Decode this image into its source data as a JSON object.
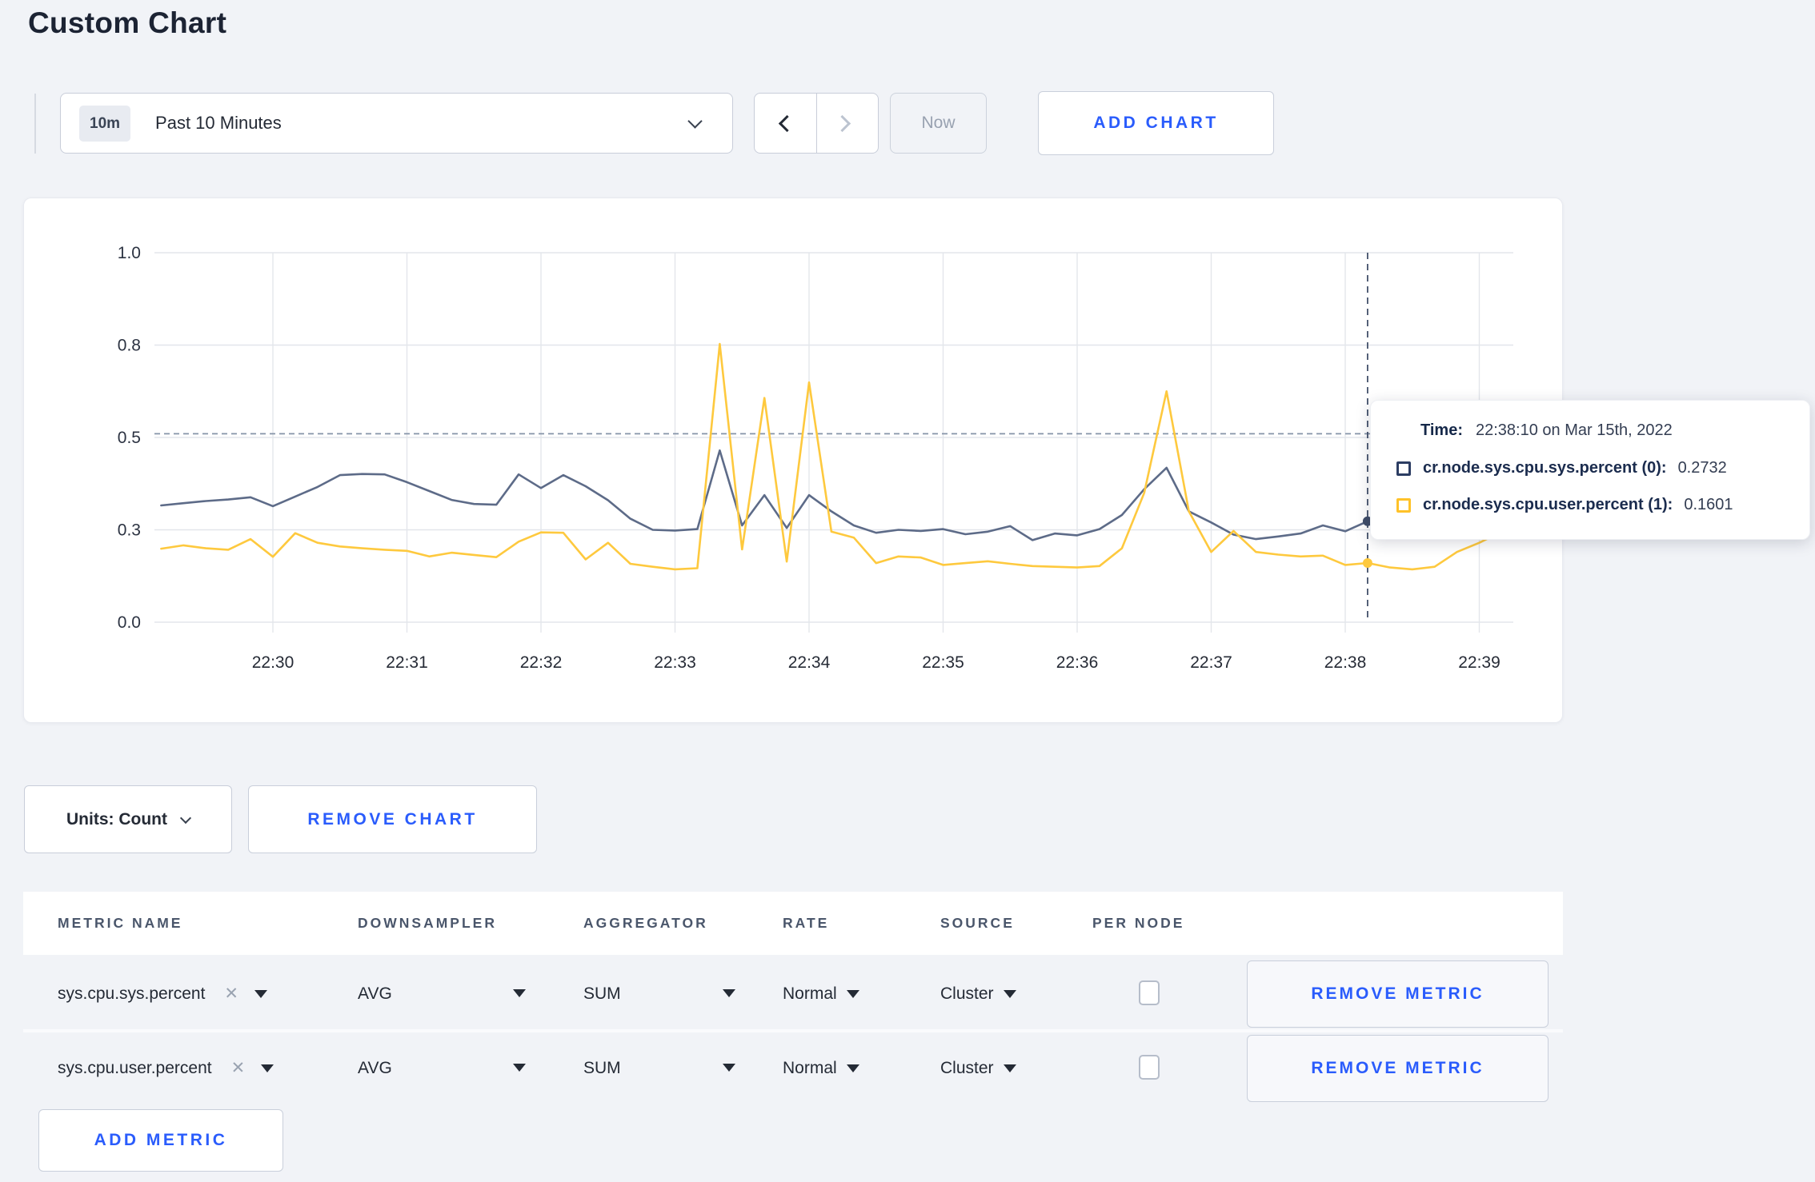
{
  "page": {
    "title": "Custom Chart"
  },
  "toolbar": {
    "time_range_badge": "10m",
    "time_range_label": "Past 10 Minutes",
    "now_label": "Now",
    "add_chart_label": "ADD CHART"
  },
  "tooltip": {
    "time_label": "Time:",
    "time_value": "22:38:10 on Mar 15th, 2022",
    "series": [
      {
        "label": "cr.node.sys.cpu.sys.percent (0):",
        "value": "0.2732",
        "swatch_color": "#2c3d63"
      },
      {
        "label": "cr.node.sys.cpu.user.percent (1):",
        "value": "0.1601",
        "swatch_color": "#ffc229"
      }
    ]
  },
  "chart_footer": {
    "units_label": "Units: Count",
    "remove_chart_label": "REMOVE CHART"
  },
  "metrics_table": {
    "headers": [
      "METRIC NAME",
      "DOWNSAMPLER",
      "AGGREGATOR",
      "RATE",
      "SOURCE",
      "PER NODE"
    ],
    "remove_metric_label": "REMOVE METRIC",
    "add_metric_label": "ADD METRIC",
    "rows": [
      {
        "metric": "sys.cpu.sys.percent",
        "downsampler": "AVG",
        "aggregator": "SUM",
        "rate": "Normal",
        "source": "Cluster",
        "per_node_checked": false
      },
      {
        "metric": "sys.cpu.user.percent",
        "downsampler": "AVG",
        "aggregator": "SUM",
        "rate": "Normal",
        "source": "Cluster",
        "per_node_checked": false
      }
    ]
  },
  "icons": {
    "remove_tag": "✕"
  },
  "chart_data": {
    "type": "line",
    "title": "",
    "xlabel": "",
    "ylabel": "",
    "grid": true,
    "legend_position": "tooltip",
    "ylim": [
      0,
      1
    ],
    "y_axis": {
      "ticks": [
        {
          "label": "1.0",
          "value": 1.0
        },
        {
          "label": "0.8",
          "value": 0.75
        },
        {
          "label": "0.5",
          "value": 0.5
        },
        {
          "label": "0.3",
          "value": 0.25
        },
        {
          "label": "0.0",
          "value": 0.0
        }
      ]
    },
    "x_axis": {
      "tick_labels": [
        "22:30",
        "22:31",
        "22:32",
        "22:33",
        "22:34",
        "22:35",
        "22:36",
        "22:37",
        "22:38",
        "22:39"
      ],
      "tick_minutes": [
        0,
        1,
        2,
        3,
        4,
        5,
        6,
        7,
        8,
        9
      ]
    },
    "x_start_minutes": -0.8333,
    "x_step_minutes": 0.16667,
    "guideline_value": 0.51,
    "crosshair": {
      "time": "22:38:10",
      "minutes": 8.1667,
      "points": [
        {
          "series": 0,
          "value": 0.2732
        },
        {
          "series": 1,
          "value": 0.1601
        }
      ]
    },
    "series": [
      {
        "name": "cr.node.sys.cpu.sys.percent",
        "color": "#5d6b88",
        "values": [
          0.316,
          0.322,
          0.328,
          0.332,
          0.338,
          0.314,
          0.34,
          0.366,
          0.398,
          0.401,
          0.4,
          0.379,
          0.355,
          0.331,
          0.32,
          0.318,
          0.4,
          0.363,
          0.398,
          0.368,
          0.33,
          0.28,
          0.25,
          0.248,
          0.252,
          0.465,
          0.262,
          0.344,
          0.255,
          0.344,
          0.3,
          0.262,
          0.242,
          0.25,
          0.247,
          0.252,
          0.238,
          0.245,
          0.26,
          0.222,
          0.24,
          0.235,
          0.252,
          0.29,
          0.36,
          0.418,
          0.3,
          0.27,
          0.237,
          0.225,
          0.232,
          0.24,
          0.262,
          0.246,
          0.2732,
          0.245,
          0.252,
          0.242,
          0.252,
          0.247,
          0.256
        ]
      },
      {
        "name": "cr.node.sys.cpu.user.percent",
        "color": "#fec93e",
        "values": [
          0.199,
          0.208,
          0.2,
          0.196,
          0.225,
          0.177,
          0.241,
          0.215,
          0.205,
          0.2,
          0.196,
          0.193,
          0.178,
          0.188,
          0.182,
          0.176,
          0.218,
          0.243,
          0.242,
          0.17,
          0.215,
          0.158,
          0.15,
          0.143,
          0.146,
          0.753,
          0.197,
          0.607,
          0.164,
          0.649,
          0.245,
          0.229,
          0.16,
          0.178,
          0.175,
          0.155,
          0.16,
          0.165,
          0.158,
          0.152,
          0.15,
          0.148,
          0.152,
          0.2,
          0.35,
          0.625,
          0.3,
          0.19,
          0.247,
          0.19,
          0.183,
          0.178,
          0.18,
          0.155,
          0.1601,
          0.148,
          0.143,
          0.15,
          0.19,
          0.215,
          0.245
        ]
      }
    ]
  }
}
